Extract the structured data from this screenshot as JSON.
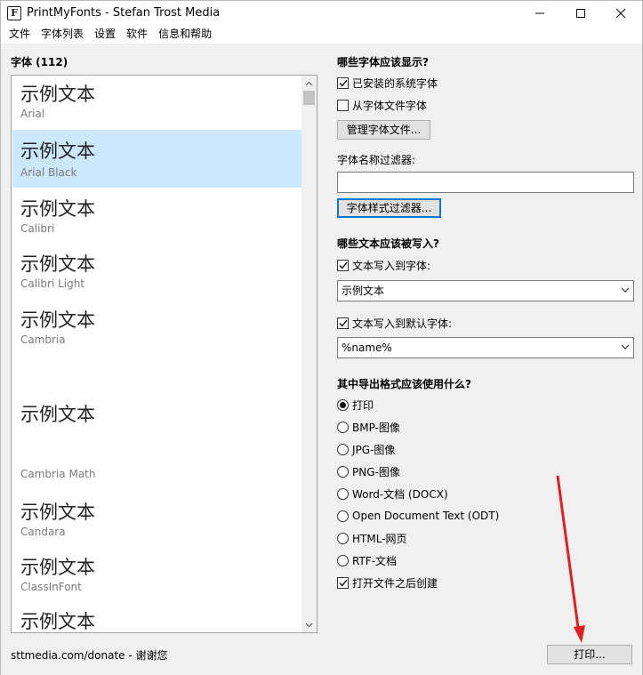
{
  "window": {
    "title": "PrintMyFonts - Stefan Trost Media",
    "icon_name": "app-logo-icon",
    "controls": [
      "minimize-icon",
      "maximize-icon",
      "close-icon"
    ]
  },
  "menu": [
    "文件",
    "字体列表",
    "设置",
    "软件",
    "信息和帮助"
  ],
  "fonts_panel": {
    "label": "字体 (112)",
    "items": [
      {
        "sample": "示例文本",
        "name": "Arial",
        "selected": false
      },
      {
        "sample": "示例文本",
        "name": "Arial Black",
        "selected": true
      },
      {
        "sample": "示例文本",
        "name": "Calibri",
        "selected": false
      },
      {
        "sample": "示例文本",
        "name": "Calibri Light",
        "selected": false
      },
      {
        "sample": "示例文本",
        "name": "Cambria",
        "selected": false
      },
      {
        "sample": "示例文本",
        "name": "Cambria Math",
        "selected": false
      },
      {
        "sample": "示例文本",
        "name": "Candara",
        "selected": false
      },
      {
        "sample": "示例文本",
        "name": "ClassInFont",
        "selected": false
      },
      {
        "sample": "示例文本",
        "name": "",
        "selected": false
      }
    ]
  },
  "display_section": {
    "title": "哪些字体应该显示?",
    "installed_label": "已安装的系统字体",
    "installed_checked": true,
    "from_files_label": "从字体文件字体",
    "from_files_checked": false,
    "manage_button": "管理字体文件...",
    "name_filter_label": "字体名称过滤器:",
    "name_filter_value": "",
    "style_filter_button": "字体样式过滤器..."
  },
  "text_section": {
    "title": "哪些文本应该被写入?",
    "write_to_font_label": "文本写入到字体:",
    "write_to_font_checked": true,
    "write_to_font_value": "示例文本",
    "write_to_default_label": "文本写入到默认字体:",
    "write_to_default_checked": true,
    "write_to_default_value": "%name%"
  },
  "export_section": {
    "title": "其中导出格式应该使用什么?",
    "options": [
      {
        "label": "打印",
        "selected": true
      },
      {
        "label": "BMP-图像",
        "selected": false
      },
      {
        "label": "JPG-图像",
        "selected": false
      },
      {
        "label": "PNG-图像",
        "selected": false
      },
      {
        "label": "Word-文档 (DOCX)",
        "selected": false
      },
      {
        "label": "Open Document Text (ODT)",
        "selected": false
      },
      {
        "label": "HTML-网页",
        "selected": false
      },
      {
        "label": "RTF-文档",
        "selected": false
      }
    ],
    "open_after_label": "打开文件之后创建",
    "open_after_checked": true
  },
  "footer": {
    "donate_text": "sttmedia.com/donate - 谢谢您",
    "print_button": "打印..."
  },
  "colors": {
    "selection": "#cce8ff",
    "annotation_arrow": "#e02020",
    "focus_border": "#0078d7"
  }
}
